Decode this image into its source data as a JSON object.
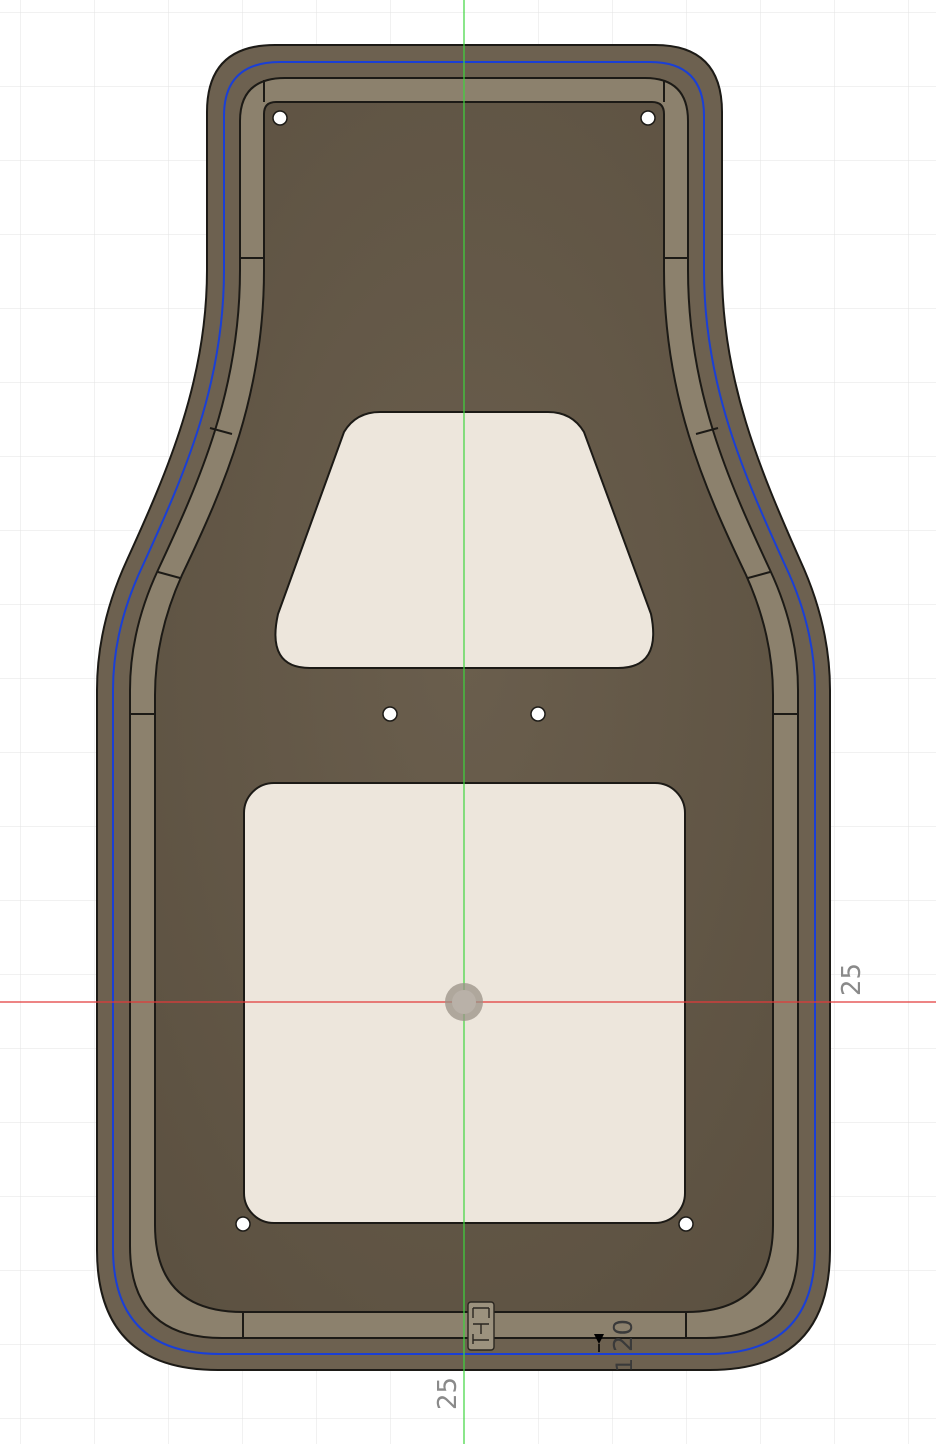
{
  "colors": {
    "background": "#ffffff",
    "grid_minor": "#e6e6e6",
    "grid_major": "#c8c8c8",
    "x_axis": "#e23a3a",
    "y_axis": "#3ed63e",
    "outer_body": "#6d6150",
    "plate": "#625646",
    "rim": "#8c816d",
    "outline": "#1c1a16",
    "profile_line": "#1a3fd6",
    "cutout": "#ede6dc",
    "hole": "#ffffff"
  },
  "dimensions": {
    "right_axis": "25",
    "bottom_axis": "25",
    "bottom_right_a": "20",
    "bottom_right_b": "1"
  },
  "icons": {
    "origin": "origin-icon",
    "embossed_text": "embossed-text-mark"
  }
}
